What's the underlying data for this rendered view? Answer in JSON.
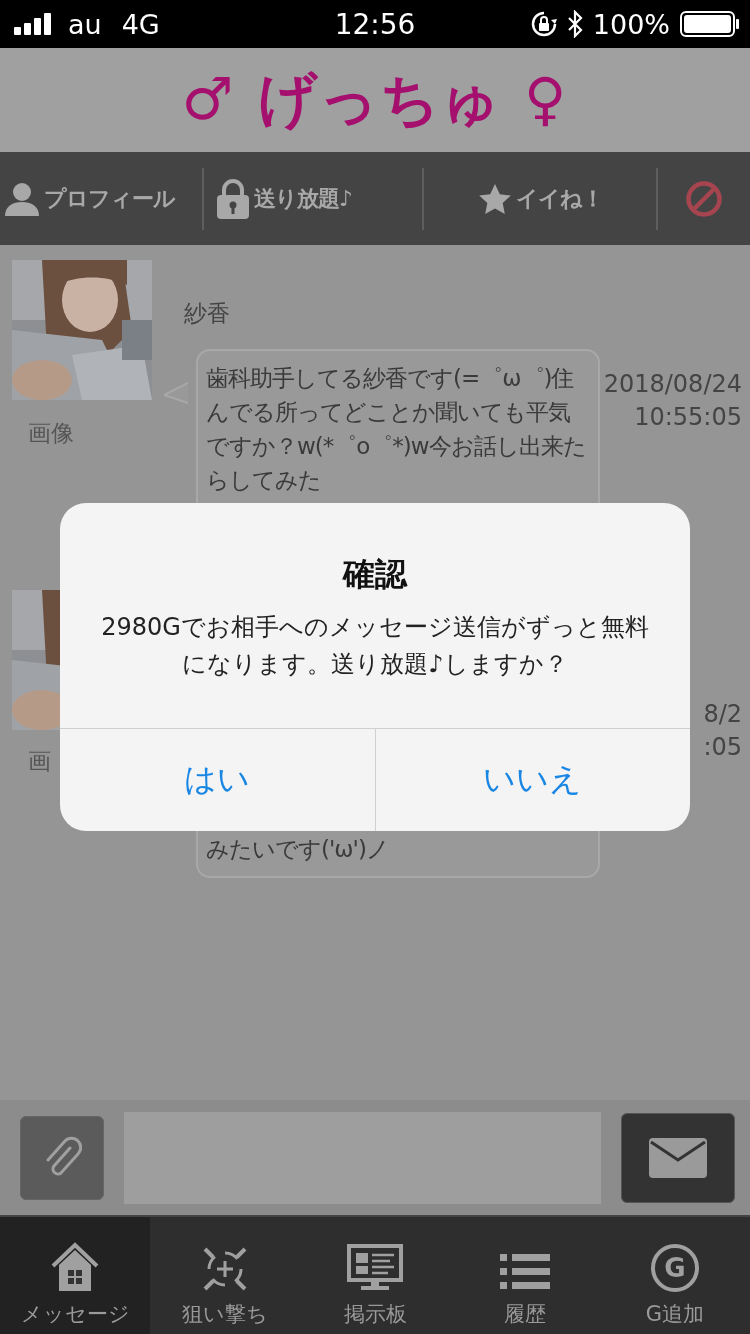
{
  "status_bar": {
    "carrier": "au",
    "network": "4G",
    "time": "12:56",
    "battery": "100%"
  },
  "header": {
    "logo": "♂ げっちゅ ♀"
  },
  "toolbar": [
    {
      "kind": "profile",
      "label": "プロフィール"
    },
    {
      "kind": "lock",
      "label": "送り放題♪"
    },
    {
      "kind": "star",
      "label": "イイね！"
    },
    {
      "kind": "block"
    }
  ],
  "messages": [
    {
      "name": "紗香",
      "caption": "画像",
      "text": " 歯科助手してる紗香です(=゜ω゜)住んでる所ってどことか聞いても平気ですか？w(*゜o゜*)w今お話し出来たらしてみた",
      "time": "2018/08/24 10:55:05"
    },
    {
      "caption": "画",
      "text": "みたいです('ω')ノ",
      "time": "8/2\n:05"
    }
  ],
  "dialog": {
    "title": "確認",
    "message": "2980Gでお相手へのメッセージ送信がずっと無料になります。送り放題♪しますか？",
    "buttons": [
      "はい",
      "いいえ"
    ]
  },
  "tabs": [
    {
      "kind": "home",
      "label": "メッセージ",
      "selected": true
    },
    {
      "kind": "target",
      "label": "狙い撃ち",
      "selected": false
    },
    {
      "kind": "board",
      "label": "掲示板",
      "selected": false
    },
    {
      "kind": "list",
      "label": "履歴",
      "selected": false
    },
    {
      "kind": "coin",
      "label": "G追加",
      "icon_text": "G",
      "selected": false
    }
  ]
}
